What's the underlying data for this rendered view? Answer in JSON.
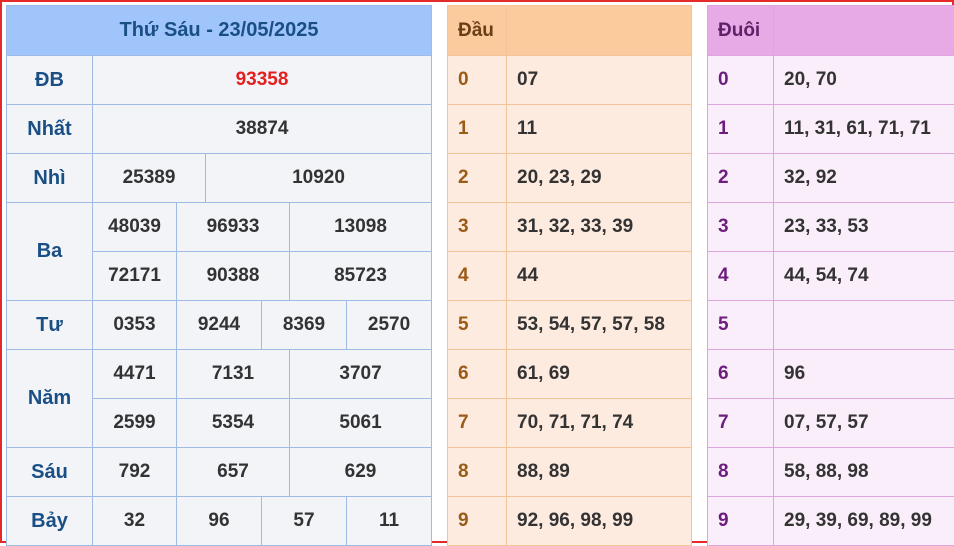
{
  "main": {
    "title": "Thứ Sáu - 23/05/2025",
    "labels": {
      "db": "ĐB",
      "nhat": "Nhất",
      "nhi": "Nhì",
      "ba": "Ba",
      "tu": "Tư",
      "nam": "Năm",
      "sau": "Sáu",
      "bay": "Bảy"
    },
    "db": "93358",
    "nhat": "38874",
    "nhi": [
      "25389",
      "10920"
    ],
    "ba": [
      "48039",
      "96933",
      "13098",
      "72171",
      "90388",
      "85723"
    ],
    "tu": [
      "0353",
      "9244",
      "8369",
      "2570"
    ],
    "nam": [
      "4471",
      "7131",
      "3707",
      "2599",
      "5354",
      "5061"
    ],
    "sau": [
      "792",
      "657",
      "629"
    ],
    "bay": [
      "32",
      "96",
      "57",
      "11"
    ]
  },
  "dau": {
    "header": "Đầu",
    "rows": [
      {
        "k": "0",
        "v": "07"
      },
      {
        "k": "1",
        "v": "11"
      },
      {
        "k": "2",
        "v": "20, 23, 29"
      },
      {
        "k": "3",
        "v": "31, 32, 33, 39"
      },
      {
        "k": "4",
        "v": "44"
      },
      {
        "k": "5",
        "v": "53, 54, 57, 57, 58"
      },
      {
        "k": "6",
        "v": "61, 69"
      },
      {
        "k": "7",
        "v": "70, 71, 71, 74"
      },
      {
        "k": "8",
        "v": "88, 89"
      },
      {
        "k": "9",
        "v": "92, 96, 98, 99"
      }
    ]
  },
  "duoi": {
    "header": "Đuôi",
    "rows": [
      {
        "k": "0",
        "v": "20, 70"
      },
      {
        "k": "1",
        "v": "11, 31, 61, 71, 71"
      },
      {
        "k": "2",
        "v": "32, 92"
      },
      {
        "k": "3",
        "v": "23, 33, 53"
      },
      {
        "k": "4",
        "v": "44, 54, 74"
      },
      {
        "k": "5",
        "v": ""
      },
      {
        "k": "6",
        "v": "96"
      },
      {
        "k": "7",
        "v": "07, 57, 57"
      },
      {
        "k": "8",
        "v": "58, 88, 98"
      },
      {
        "k": "9",
        "v": "29, 39, 69, 89, 99"
      }
    ]
  },
  "colors": {
    "frame": "#e52a2a",
    "main_header": "#9fc5fb",
    "special_prize": "#e32020",
    "dau_header": "#fbca9d",
    "duoi_header": "#e7aae7"
  }
}
